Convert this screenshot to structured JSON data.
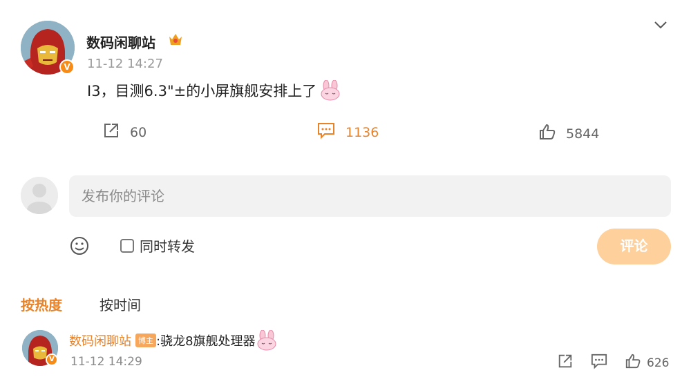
{
  "post": {
    "author": "数码闲聊站",
    "time": "11-12 14:27",
    "content": "I3，目测6.3\"±的小屏旗舰安排上了",
    "icons": {
      "avatar": "iron-man-avatar",
      "badge": "verified-v-badge",
      "crown": "crown-icon",
      "more": "chevron-down-icon",
      "emoji": "bunny-emoji"
    }
  },
  "actions": {
    "share_count": "60",
    "comment_count": "1136",
    "like_count": "5844",
    "colors": {
      "active": "#e8832a",
      "default": "#666666"
    }
  },
  "composer": {
    "placeholder": "发布你的评论",
    "repost_label": "同时转发",
    "submit_label": "评论",
    "submit_color": "#fdd09c"
  },
  "sort": {
    "hot_label": "按热度",
    "time_label": "按时间"
  },
  "comment": {
    "author": "数码闲聊站",
    "badge": "博主",
    "text": ":骁龙8旗舰处理器",
    "time": "11-12 14:29",
    "like_count": "626"
  }
}
